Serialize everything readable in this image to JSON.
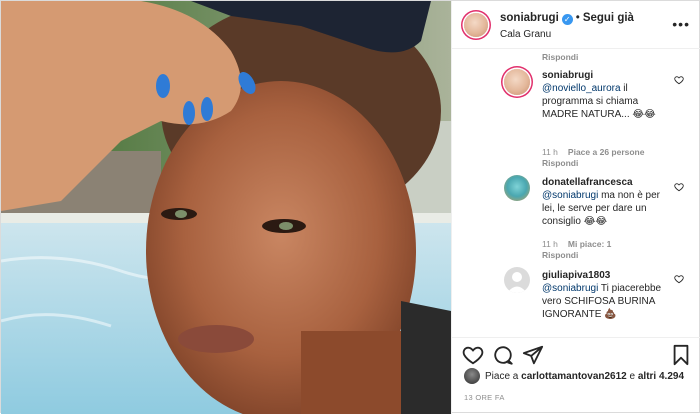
{
  "header": {
    "username": "soniabrugi",
    "verified_glyph": "✓",
    "separator": "•",
    "follow_label": "Segui già",
    "location": "Cala Granu",
    "more_glyph": "•••"
  },
  "comments": {
    "top_reply_label": "Rispondi",
    "items": [
      {
        "username": "soniabrugi",
        "mention": "@noviello_aurora",
        "text": " il programma si chiama MADRE NATURA... 😂😂",
        "time": "11 h",
        "likes": "Piace a 26 persone",
        "reply": "Rispondi"
      },
      {
        "username": "donatellafrancesca",
        "mention": "@soniabrugi",
        "text": " ma non è per lei, le serve per dare un consiglio 😂😂",
        "time": "11 h",
        "likes": "Mi piace: 1",
        "reply": "Rispondi"
      },
      {
        "username": "giuliapiva1803",
        "mention": "@soniabrugi",
        "text": " Ti piacerebbe vero SCHIFOSA BURINA IGNORANTE 💩"
      }
    ]
  },
  "footer": {
    "likes_prefix": "Piace a ",
    "likes_user": "carlottamantovan2612",
    "likes_middle": " e ",
    "likes_others": "altri 4.294",
    "time_ago": "13 ORE FA"
  },
  "icons": {
    "like": "heart-icon",
    "comment": "comment-icon",
    "share": "share-icon",
    "save": "bookmark-icon"
  },
  "colors": {
    "link": "#00376b",
    "muted": "#8e8e8e",
    "verified": "#3897f0",
    "text": "#262626"
  }
}
